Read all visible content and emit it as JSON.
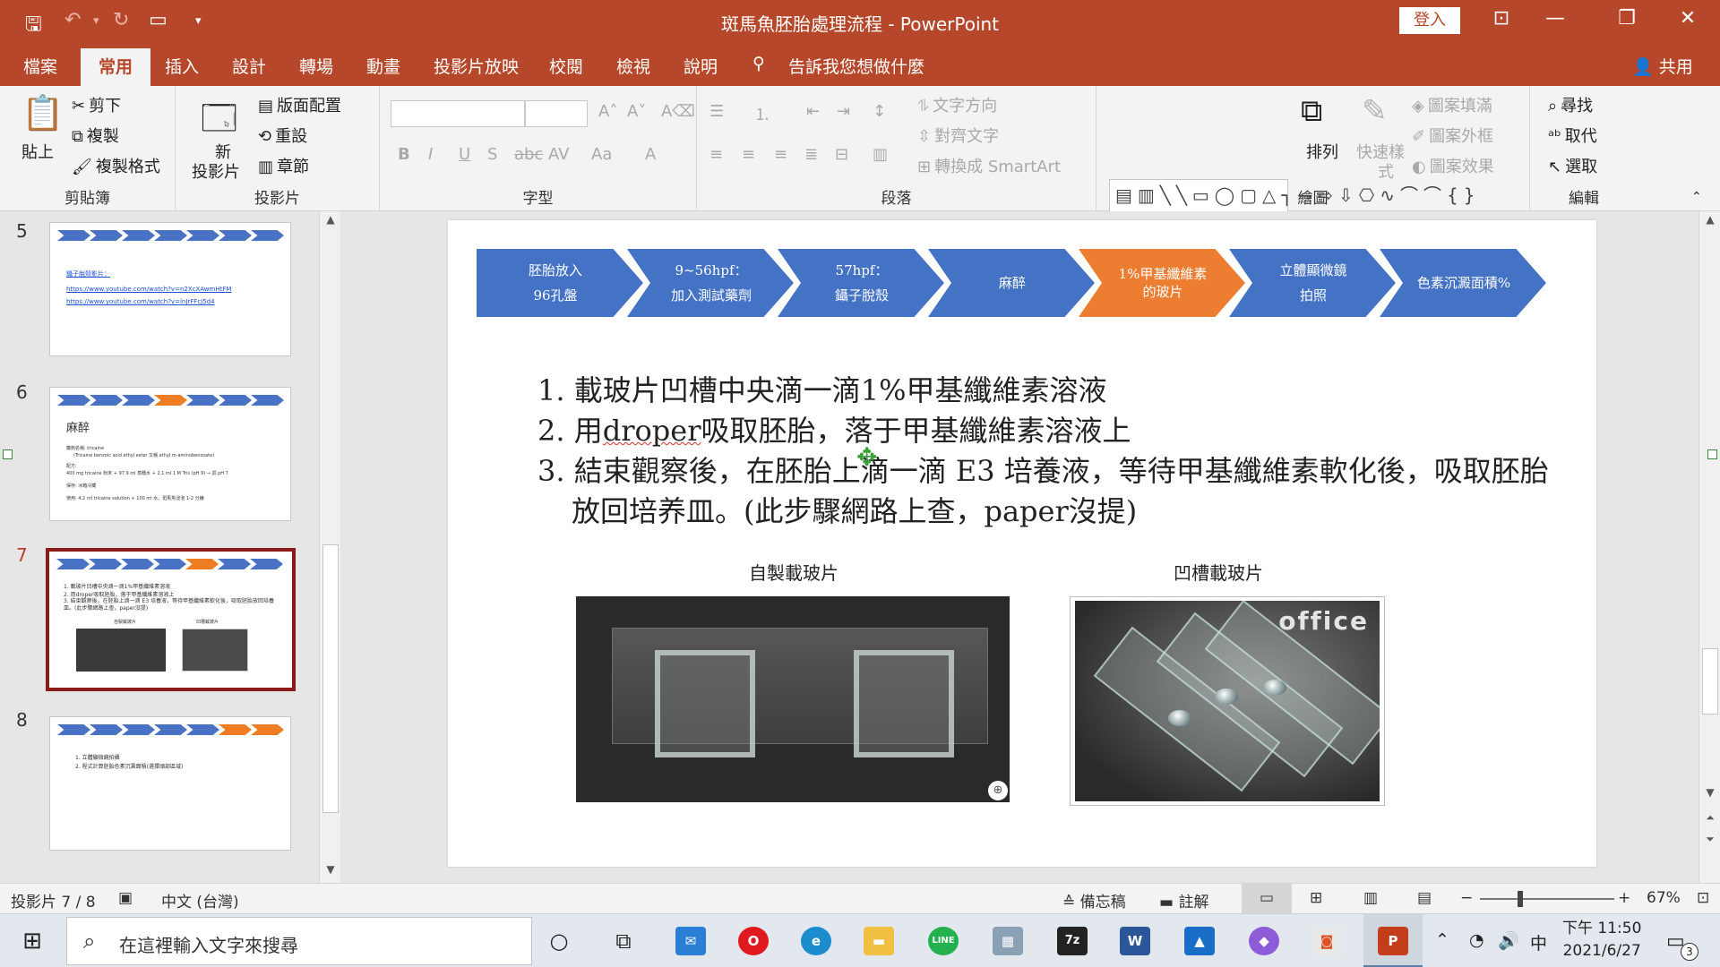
{
  "titlebar": {
    "title": "斑馬魚胚胎處理流程  -  PowerPoint",
    "login": "登入"
  },
  "tabs": [
    "檔案",
    "常用",
    "插入",
    "設計",
    "轉場",
    "動畫",
    "投影片放映",
    "校閱",
    "檢視",
    "說明"
  ],
  "tell_me": "告訴我您想做什麼",
  "share": "共用",
  "ribbon": {
    "clipboard": {
      "label": "剪貼簿",
      "paste": "貼上",
      "cut": "剪下",
      "copy": "複製",
      "format_painter": "複製格式"
    },
    "slides": {
      "label": "投影片",
      "new_slide_1": "新",
      "new_slide_2": "投影片",
      "layout": "版面配置",
      "reset": "重設",
      "section": "章節"
    },
    "font": {
      "label": "字型"
    },
    "paragraph": {
      "label": "段落",
      "text_direction": "文字方向",
      "align_text": "對齊文字",
      "smartart": "轉換成 SmartArt"
    },
    "drawing": {
      "label": "繪圖",
      "arrange": "排列",
      "quick_styles_1": "快速樣",
      "quick_styles_2": "式",
      "shape_fill": "圖案填滿",
      "shape_outline": "圖案外框",
      "shape_effects": "圖案效果"
    },
    "editing": {
      "label": "編輯",
      "find": "尋找",
      "replace": "取代",
      "select": "選取"
    }
  },
  "thumbnails": {
    "numbers": [
      "5",
      "6",
      "7",
      "8"
    ],
    "slide5_link_title": "鑷子脫殼影片：",
    "slide5_link1": "https://www.youtube.com/watch?v=n2XcXAwmHtFM",
    "slide5_link2": "https://www.youtube.com/watch?v=lnJrFFcJ5d4",
    "slide6_title": "麻醉",
    "slide6_l1": "藥劑名稱: tricaine",
    "slide6_l2": "(Tricaine benzoic acid ethyl ester 又稱 ethyl m-aminobenzoate)",
    "slide6_l3": "配方:",
    "slide6_l4": "400 mg tricaine 粉末 + 97.9 ml 蒸餾水 + 2.1 ml 1 M Tris (pH 9) → 調 pH 7",
    "slide6_l5": "保存: 冰箱冷藏",
    "slide6_l6": "使用: 4.2 ml tricaine solution + 100 ml 水，斑馬魚浸泡 1-2 分鐘",
    "slide7_l1": "1. 載玻片凹槽中央滴一滴1%甲基纖維素溶液",
    "slide7_l2": "2. 用droper吸取胚胎，落于甲基纖維素溶液上",
    "slide7_l3": "3. 結束觀察後，在胚胎上滴一滴 E3 培養液，等待甲基纖維素軟化後，吸取胚胎放回培養皿。(此步驟網路上查，paper沒提)",
    "slide7_cap1": "自製載玻片",
    "slide7_cap2": "凹槽載玻片",
    "slide8_l1": "1.  立體顯微鏡拍攝",
    "slide8_l2": "2.  程式計算胚胎色素沉澱面積(選擇頭部區域)"
  },
  "slide": {
    "flow": [
      {
        "line1": "胚胎放入",
        "line2": "96孔盤",
        "color": "#4472c4"
      },
      {
        "line1": "9~56hpf：",
        "line2": "加入測試藥劑",
        "color": "#4472c4"
      },
      {
        "line1": "57hpf：",
        "line2": "鑷子脫殼",
        "color": "#4472c4"
      },
      {
        "line1": "麻醉",
        "line2": "",
        "color": "#4472c4"
      },
      {
        "line1": "1%甲基纖維素",
        "line2": "的玻片",
        "color": "#ed7d31"
      },
      {
        "line1": "立體顯微鏡",
        "line2": "拍照",
        "color": "#4472c4"
      },
      {
        "line1": "色素沉澱面積%",
        "line2": "",
        "color": "#4472c4"
      }
    ],
    "step1": "1. 載玻片凹槽中央滴一滴1%甲基纖維素溶液",
    "step2_pre": "2. 用",
    "step2_word": "droper",
    "step2_post": "吸取胚胎，落于甲基纖維素溶液上",
    "step3": "3. 結束觀察後，在胚胎上滴一滴 E3 培養液，等待甲基纖維素軟化後，吸取胚胎放回培养皿。(此步驟網路上查，paper沒提)",
    "caption1": "自製載玻片",
    "caption2": "凹槽載玻片",
    "photo2_text": "office"
  },
  "statusbar": {
    "slide_pos": "投影片 7 / 8",
    "language": "中文 (台灣)",
    "notes": "備忘稿",
    "comments": "註解",
    "zoom": "67%"
  },
  "taskbar": {
    "search_placeholder": "在這裡輸入文字來搜尋",
    "ime": "中",
    "time": "下午 11:50",
    "date": "2021/6/27",
    "notification_count": "3"
  }
}
